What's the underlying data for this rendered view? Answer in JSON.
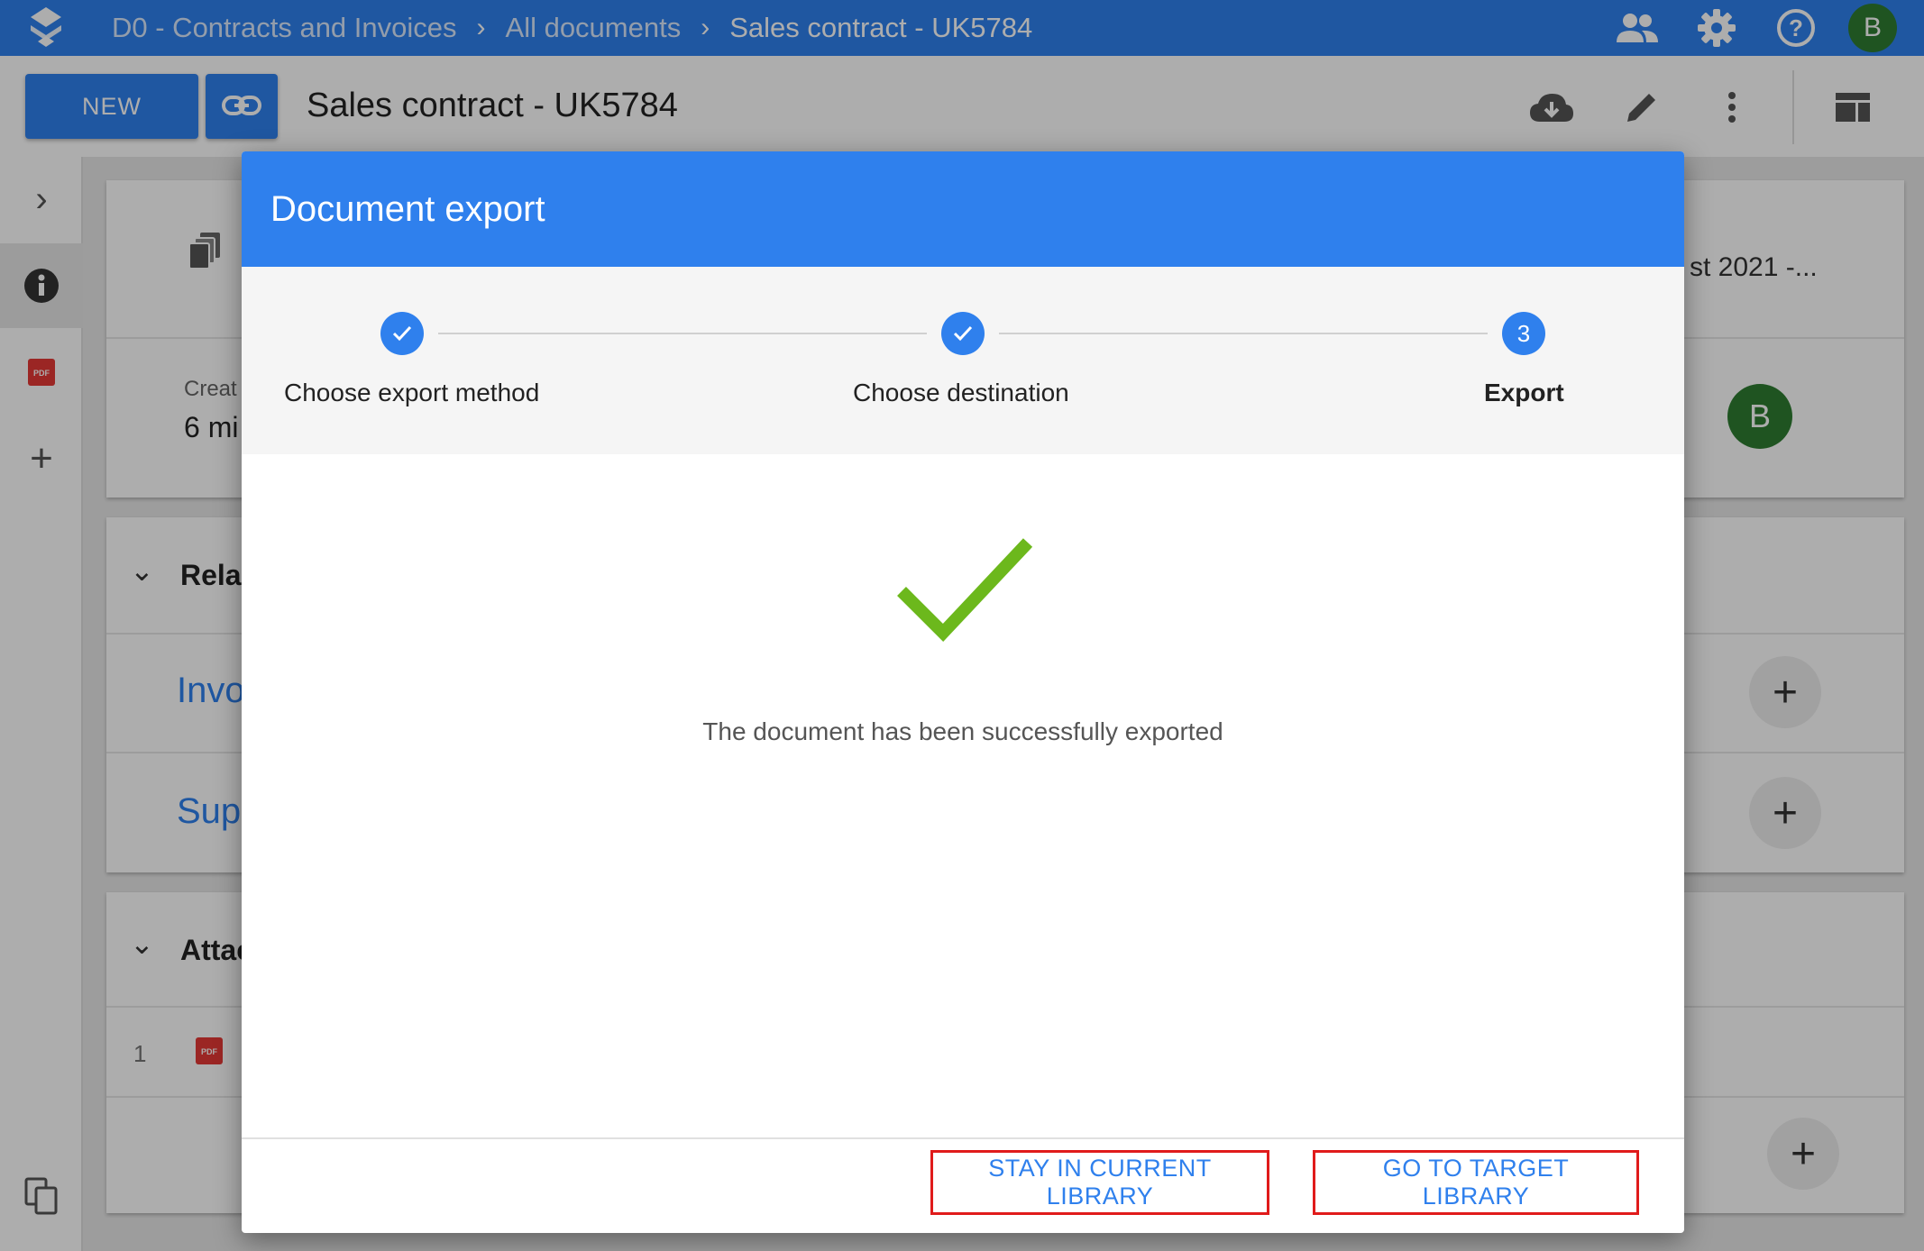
{
  "topbar": {
    "breadcrumbs": [
      "D0 - Contracts and Invoices",
      "All documents",
      "Sales contract - UK5784"
    ],
    "avatar_initial": "B",
    "icons": [
      "people-icon",
      "gear-icon",
      "help-icon"
    ]
  },
  "toolbar": {
    "new_label": "NEW",
    "doc_title": "Sales contract - UK5784",
    "icons": [
      "cloud-download-icon",
      "pencil-icon",
      "more-vert-icon",
      "layout-icon"
    ]
  },
  "background": {
    "partial_date": "st 2021 -...",
    "created_label": "Creat",
    "created_value": "6 mi",
    "avatar_initial": "B",
    "related_head": "Relat",
    "link_invoices": "Invo",
    "link_supplier": "Supp",
    "attachments_head": "Attac",
    "attachment_index": "1"
  },
  "dialog": {
    "title": "Document export",
    "steps": [
      {
        "label": "Choose export method",
        "status": "done"
      },
      {
        "label": "Choose destination",
        "status": "done"
      },
      {
        "label": "Export",
        "status": "current",
        "number": "3"
      }
    ],
    "message": "The document has been successfully exported",
    "buttons": {
      "stay": "STAY IN CURRENT LIBRARY",
      "go": "GO TO TARGET LIBRARY"
    }
  },
  "colors": {
    "primary": "#2f80ed",
    "success": "#6cb81c",
    "highlight": "#e01b1b",
    "avatar": "#2e7d32"
  }
}
